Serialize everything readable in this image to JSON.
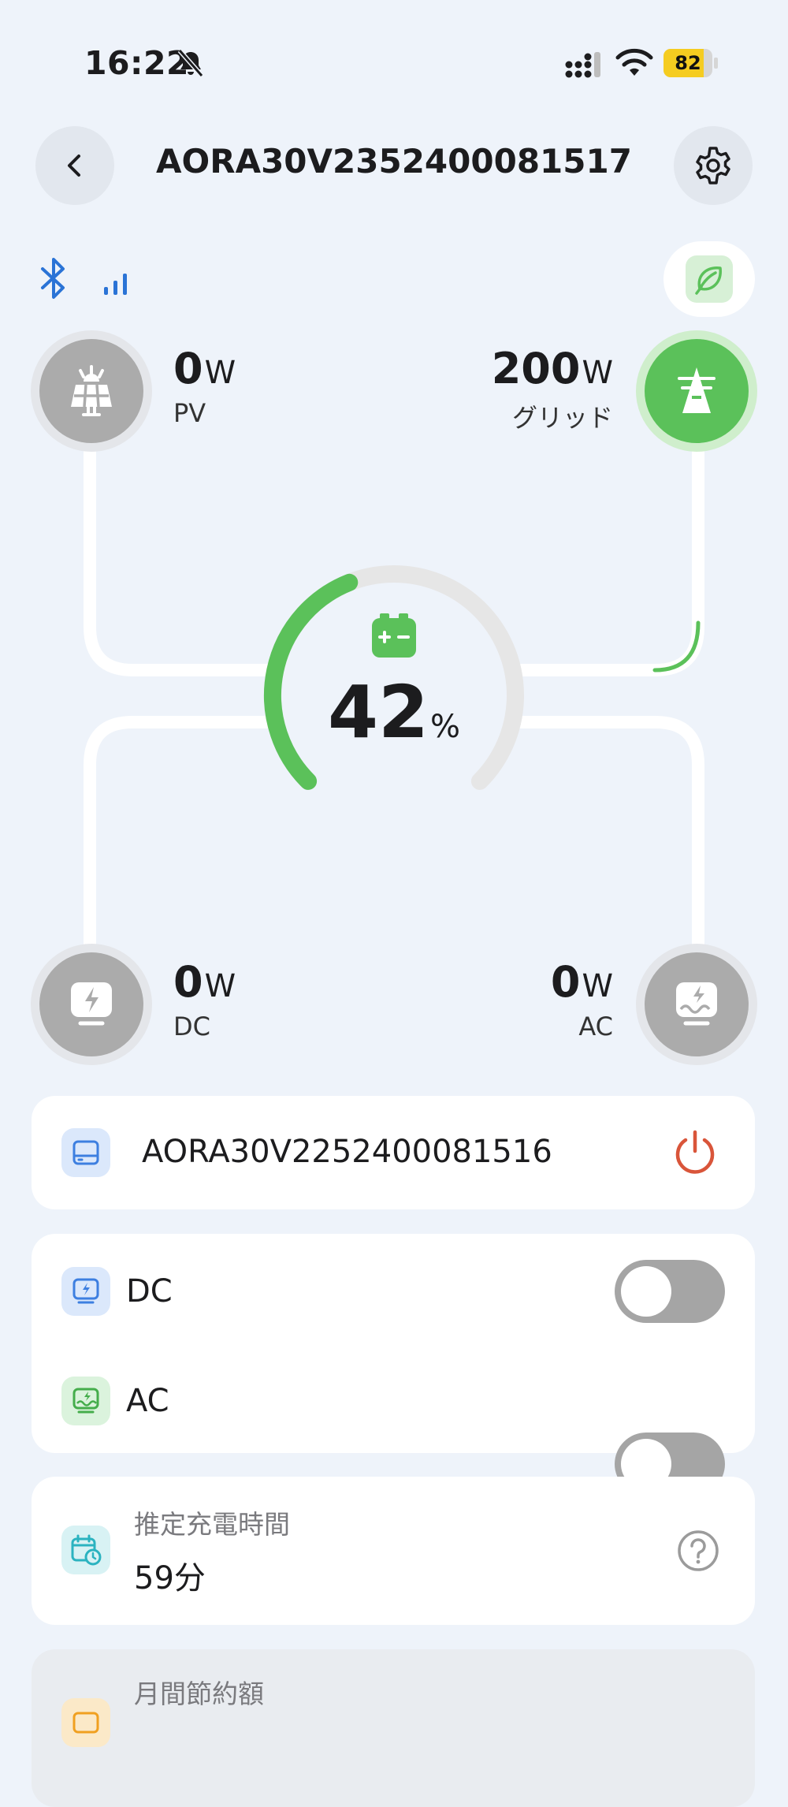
{
  "status_bar": {
    "time": "16:22",
    "battery_level": "82",
    "battery_fraction": 0.82,
    "bell_icon": "bell-slash-icon",
    "signal_icon": "cellular-signal-icon",
    "wifi_icon": "wifi-icon"
  },
  "header": {
    "title": "AORA30V2352400081517",
    "back_icon": "chevron-left-icon",
    "settings_icon": "gear-icon"
  },
  "connectivity": {
    "bluetooth_icon": "bluetooth-icon",
    "signal_icon": "signal-bars-icon",
    "eco_icon": "leaf-icon"
  },
  "flow": {
    "pv": {
      "value": "0",
      "unit": "W",
      "label": "PV"
    },
    "grid": {
      "value": "200",
      "unit": "W",
      "label": "グリッド"
    },
    "dc": {
      "value": "0",
      "unit": "W",
      "label": "DC"
    },
    "ac": {
      "value": "0",
      "unit": "W",
      "label": "AC"
    },
    "battery": {
      "value": "42",
      "unit": "%",
      "fraction": 0.42
    }
  },
  "device_card": {
    "name": "AORA30V2252400081516",
    "power_icon": "power-icon"
  },
  "outputs": {
    "dc": {
      "label": "DC",
      "on": false
    },
    "ac": {
      "label": "AC",
      "on": false
    }
  },
  "estimate": {
    "label": "推定充電時間",
    "value": "59分",
    "help_icon": "question-icon"
  },
  "savings": {
    "label": "月間節約額"
  },
  "colors": {
    "accent_green": "#5bc15a",
    "battery_yellow": "#f5cc20",
    "power_red": "#d9553a",
    "inactive_gray": "#ababab"
  }
}
